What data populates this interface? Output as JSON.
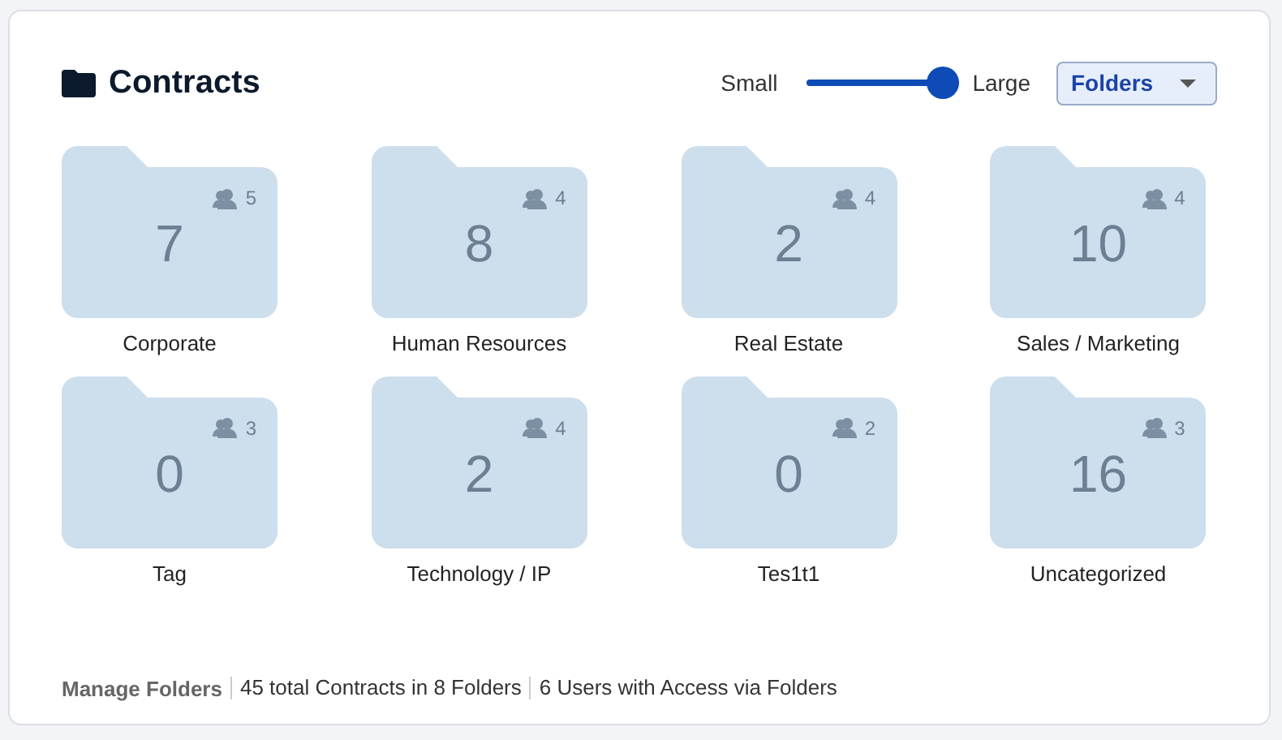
{
  "header": {
    "title": "Contracts"
  },
  "size_slider": {
    "min_label": "Small",
    "max_label": "Large",
    "level": 1
  },
  "view_dropdown": {
    "value": "Folders"
  },
  "folders": [
    {
      "name": "Corporate",
      "count": "7",
      "users": "5"
    },
    {
      "name": "Human Resources",
      "count": "8",
      "users": "4"
    },
    {
      "name": "Real Estate",
      "count": "2",
      "users": "4"
    },
    {
      "name": "Sales / Marketing",
      "count": "10",
      "users": "4"
    },
    {
      "name": "Tag",
      "count": "0",
      "users": "3"
    },
    {
      "name": "Technology / IP",
      "count": "2",
      "users": "4"
    },
    {
      "name": "Tes1t1",
      "count": "0",
      "users": "2"
    },
    {
      "name": "Uncategorized",
      "count": "16",
      "users": "3"
    }
  ],
  "footer": {
    "link": "Manage Folders",
    "items": [
      "45 total Contracts in 8 Folders",
      "6 Users with Access via Folders"
    ]
  }
}
